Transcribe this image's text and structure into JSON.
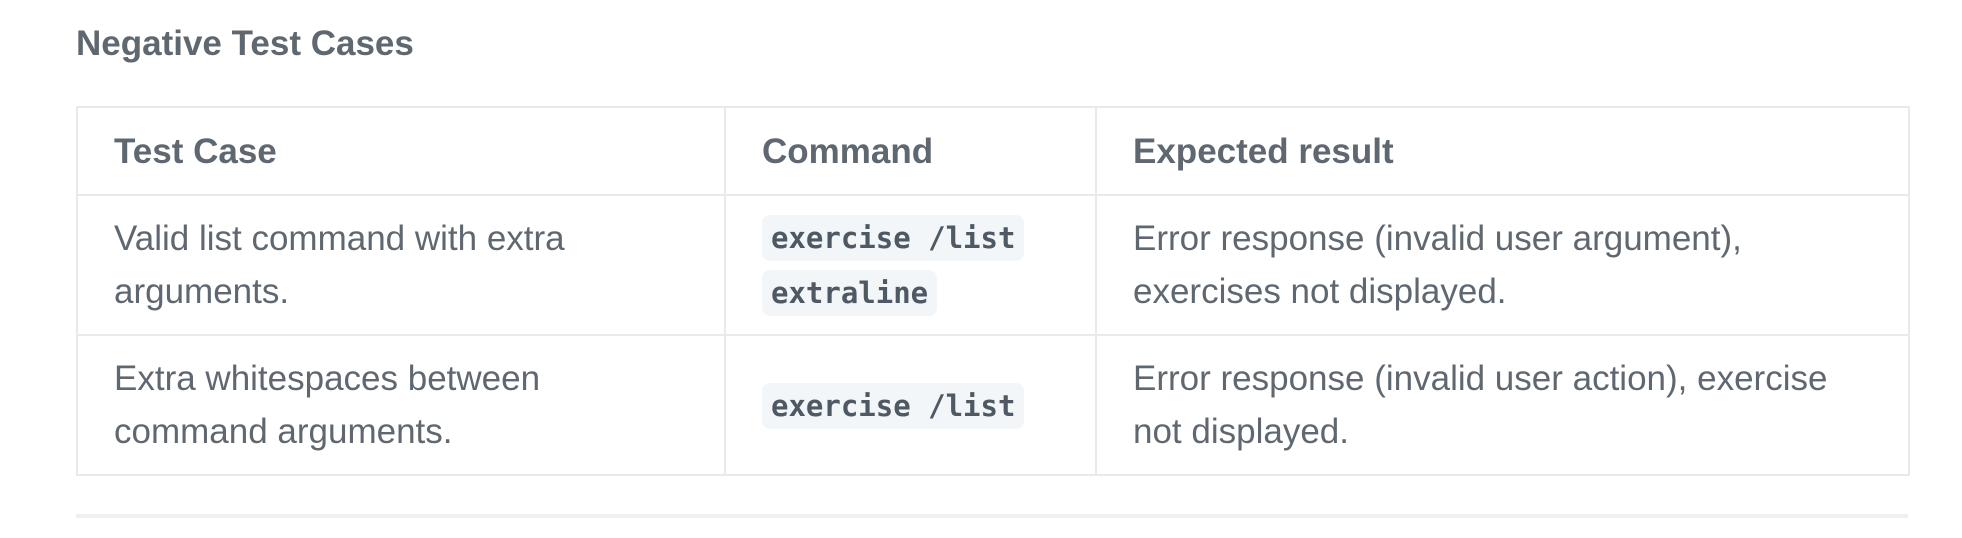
{
  "heading": "Negative Test Cases",
  "table": {
    "headers": [
      "Test Case",
      "Command",
      "Expected result"
    ],
    "rows": [
      {
        "test_case": "Valid list command with extra arguments.",
        "command": "exercise /list extraline",
        "expected": "Error response (invalid user argument), exercises not displayed."
      },
      {
        "test_case": "Extra whitespaces between command arguments.",
        "command": "exercise /list",
        "expected": "Error response (invalid user action), exercise not displayed."
      }
    ]
  },
  "colors": {
    "text": "#5f6870",
    "border": "#e8eaec",
    "code_bg": "#f3f6f9"
  }
}
